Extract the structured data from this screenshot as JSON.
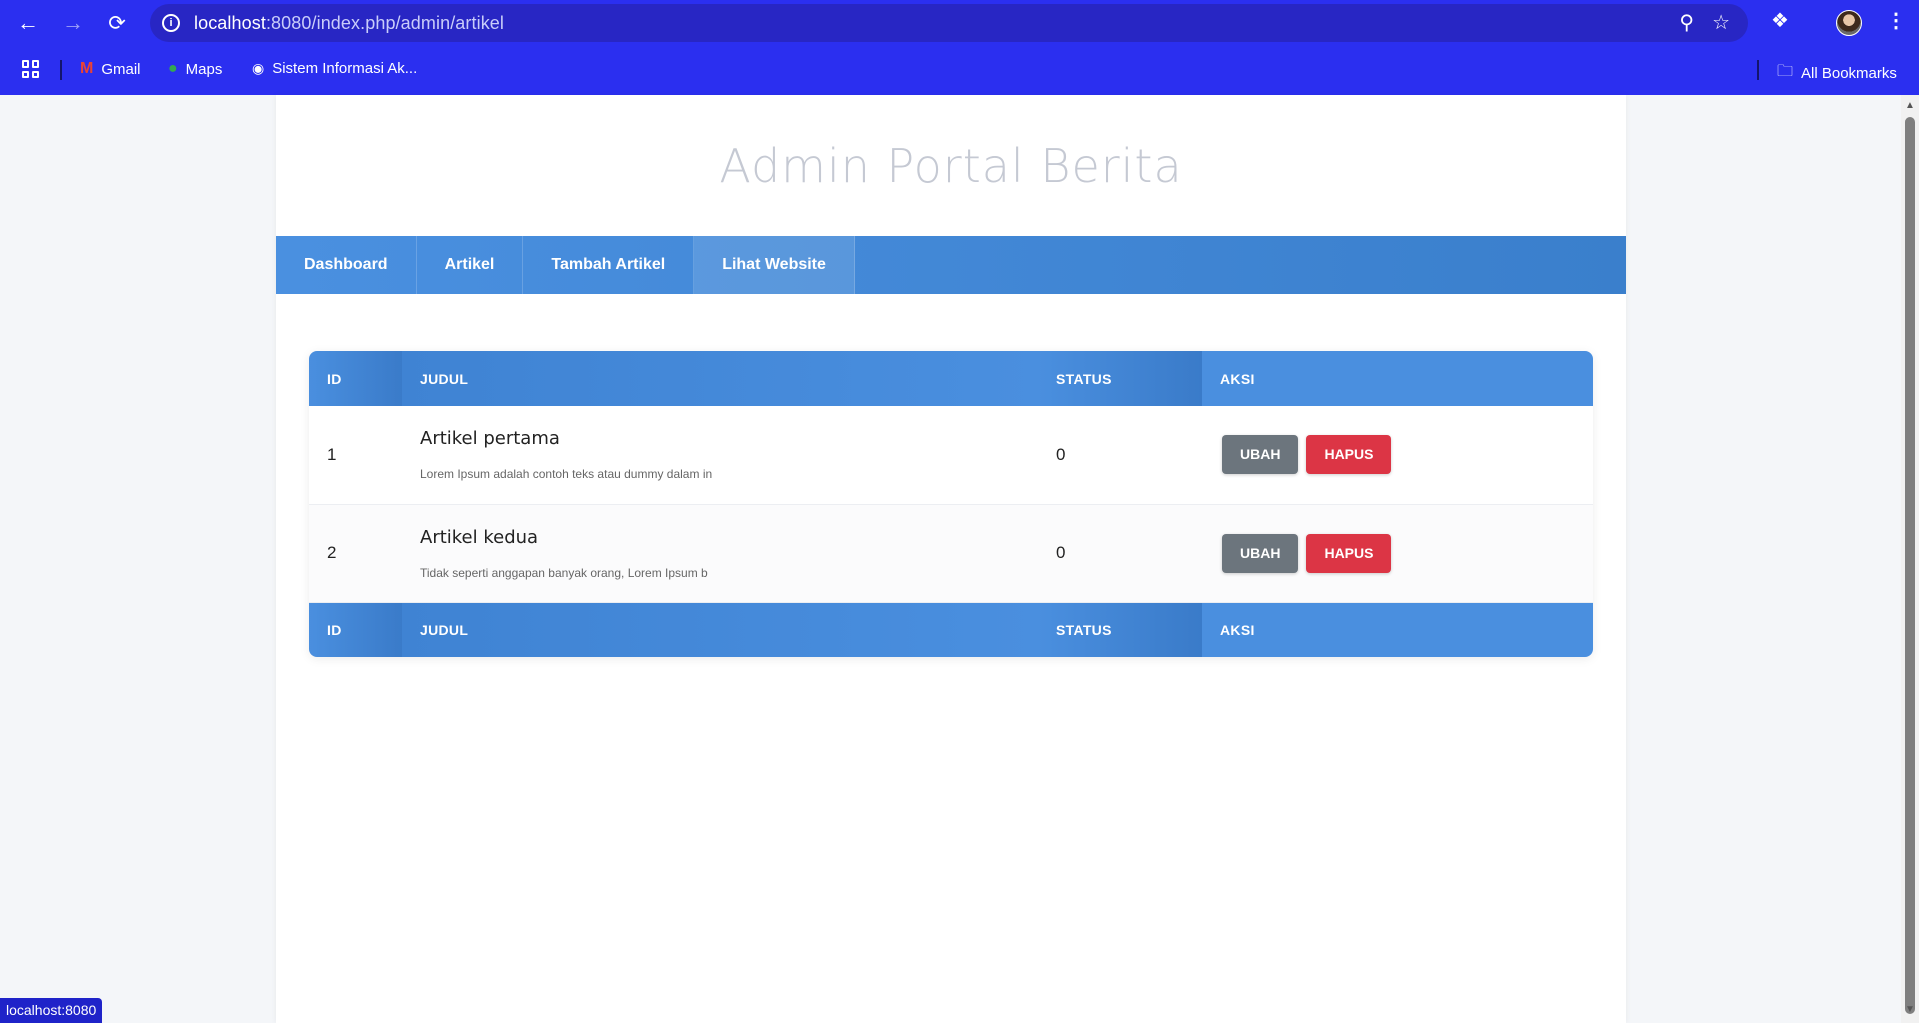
{
  "browser": {
    "url_host": "localhost",
    "url_rest": ":8080/index.php/admin/artikel",
    "bookmarks": [
      {
        "label": "Gmail"
      },
      {
        "label": "Maps"
      },
      {
        "label": "Sistem Informasi Ak..."
      }
    ],
    "all_bookmarks": "All Bookmarks",
    "status_tip": "localhost:8080"
  },
  "site": {
    "title": "Admin Portal Berita",
    "menu": [
      "Dashboard",
      "Artikel",
      "Tambah Artikel",
      "Lihat Website"
    ]
  },
  "table": {
    "headers": [
      "ID",
      "JUDUL",
      "STATUS",
      "AKSI"
    ],
    "rows": [
      {
        "id": "1",
        "title": "Artikel pertama",
        "excerpt": "Lorem Ipsum adalah contoh teks atau dummy dalam in",
        "status": "0"
      },
      {
        "id": "2",
        "title": "Artikel kedua",
        "excerpt": "Tidak seperti anggapan banyak orang, Lorem Ipsum b",
        "status": "0"
      }
    ],
    "btn_edit": "UBAH",
    "btn_delete": "HAPUS"
  },
  "colors": {
    "chrome": "#2b2ff0",
    "menu": "#4a90e0",
    "edit": "#6c757d",
    "delete": "#dc3545"
  }
}
